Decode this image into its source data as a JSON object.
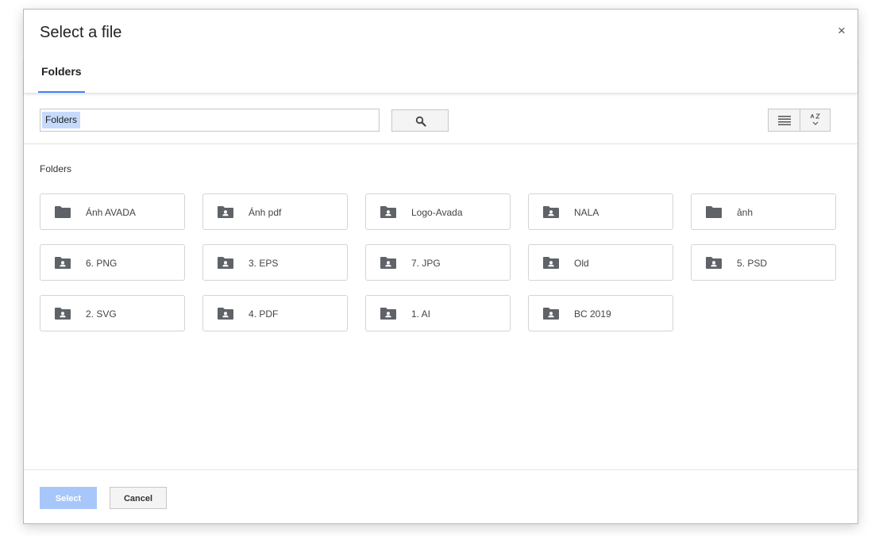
{
  "dialog": {
    "title": "Select a file",
    "close_label": "×"
  },
  "tabs": [
    {
      "label": "Folders",
      "active": true
    }
  ],
  "search": {
    "value": "Folders"
  },
  "section": {
    "label": "Folders"
  },
  "folders": [
    {
      "name": "Ánh AVADA",
      "shared": false
    },
    {
      "name": "Ánh pdf",
      "shared": true
    },
    {
      "name": "Logo-Avada",
      "shared": true
    },
    {
      "name": "NALA",
      "shared": true
    },
    {
      "name": "ảnh",
      "shared": false
    },
    {
      "name": "6. PNG",
      "shared": true
    },
    {
      "name": "3. EPS",
      "shared": true
    },
    {
      "name": "7. JPG",
      "shared": true
    },
    {
      "name": "Old",
      "shared": true
    },
    {
      "name": "5. PSD",
      "shared": true
    },
    {
      "name": "2. SVG",
      "shared": true
    },
    {
      "name": "4. PDF",
      "shared": true
    },
    {
      "name": "1. AI",
      "shared": true
    },
    {
      "name": "BC 2019",
      "shared": true
    }
  ],
  "footer": {
    "select_label": "Select",
    "cancel_label": "Cancel"
  },
  "colors": {
    "accent": "#4285f4",
    "select_disabled": "#a7c6fa",
    "folder_icon": "#5f6368"
  }
}
